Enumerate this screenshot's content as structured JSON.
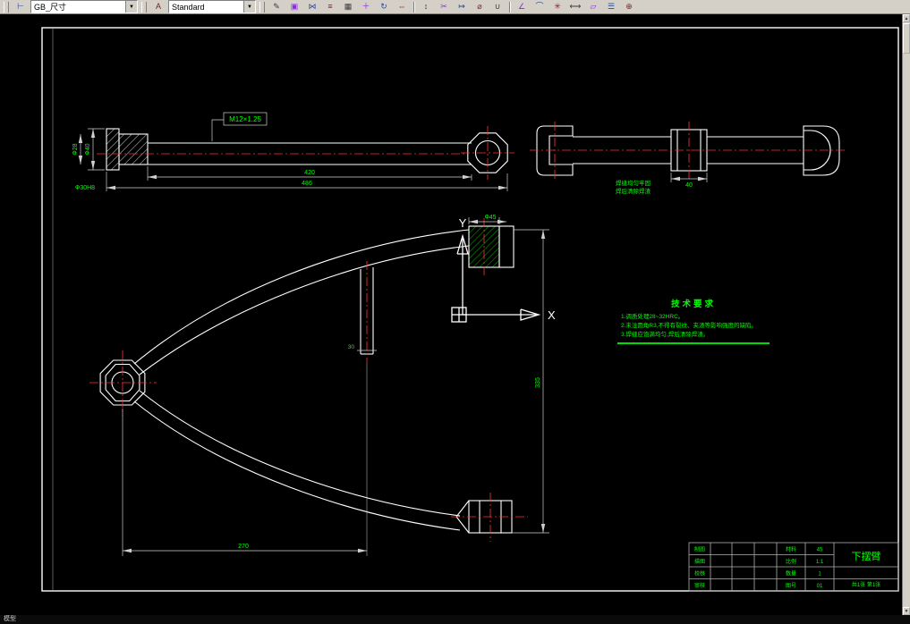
{
  "toolbar": {
    "dim_style": "GB_尺寸",
    "text_style": "Standard",
    "icons": [
      {
        "name": "erase",
        "glyph": "✎"
      },
      {
        "name": "copy",
        "glyph": "▣"
      },
      {
        "name": "mirror",
        "glyph": "⋈"
      },
      {
        "name": "offset",
        "glyph": "≡"
      },
      {
        "name": "array",
        "glyph": "▦"
      },
      {
        "name": "move",
        "glyph": "＋"
      },
      {
        "name": "rotate",
        "glyph": "↻"
      },
      {
        "name": "scale",
        "glyph": "⇔"
      },
      {
        "name": "stretch",
        "glyph": "↕"
      },
      {
        "name": "trim",
        "glyph": "✂"
      },
      {
        "name": "extend",
        "glyph": "↦"
      },
      {
        "name": "diameter",
        "glyph": "⌀"
      },
      {
        "name": "join",
        "glyph": "∪"
      },
      {
        "name": "angle",
        "glyph": "∠"
      },
      {
        "name": "fillet",
        "glyph": "⌒"
      },
      {
        "name": "explode",
        "glyph": "✳"
      },
      {
        "name": "distance",
        "glyph": "⟷"
      },
      {
        "name": "area",
        "glyph": "▱"
      },
      {
        "name": "list",
        "glyph": "☰"
      },
      {
        "name": "point",
        "glyph": "⊕"
      }
    ]
  },
  "drawing": {
    "views": {
      "top_view": {
        "thread_label": "M12×1.25",
        "dia_outer": "Ф40",
        "dia_inner": "Ф28",
        "bore_label": "Ф30H8",
        "len_body": "420",
        "len_total": "486"
      },
      "side_view": {
        "note1": "焊缝均匀牢固",
        "note2": "焊后清除焊渣",
        "bush_width": "40"
      },
      "main_view": {
        "boss_dia": "Ф45",
        "tube_width": "30",
        "height_dim": "335",
        "width_dim": "270"
      }
    },
    "ucs": {
      "x": "X",
      "y": "Y"
    },
    "tech_requirements": {
      "title": "技术要求",
      "lines": [
        "1.调质处理28~32HRC。",
        "2.未注圆角R3,不得有裂纹、夹渣等影响强度的缺陷。",
        "3.焊缝应饱满均匀,焊后清除焊渣。"
      ]
    },
    "title_block": {
      "part_name": "下摆臂",
      "material_label": "材料",
      "material": "45",
      "scale_label": "比例",
      "scale": "1:1",
      "qty_label": "数量",
      "qty": "1",
      "no_label": "图号",
      "no": "01",
      "row_labels": [
        "制图",
        "描图",
        "校核",
        "审核"
      ],
      "sheet": "共1张 第1张"
    },
    "colors": {
      "line": "#ffffff",
      "dim_text": "#00ff00",
      "centerline": "#ff3232"
    }
  },
  "statusbar": {
    "text": "模型"
  }
}
